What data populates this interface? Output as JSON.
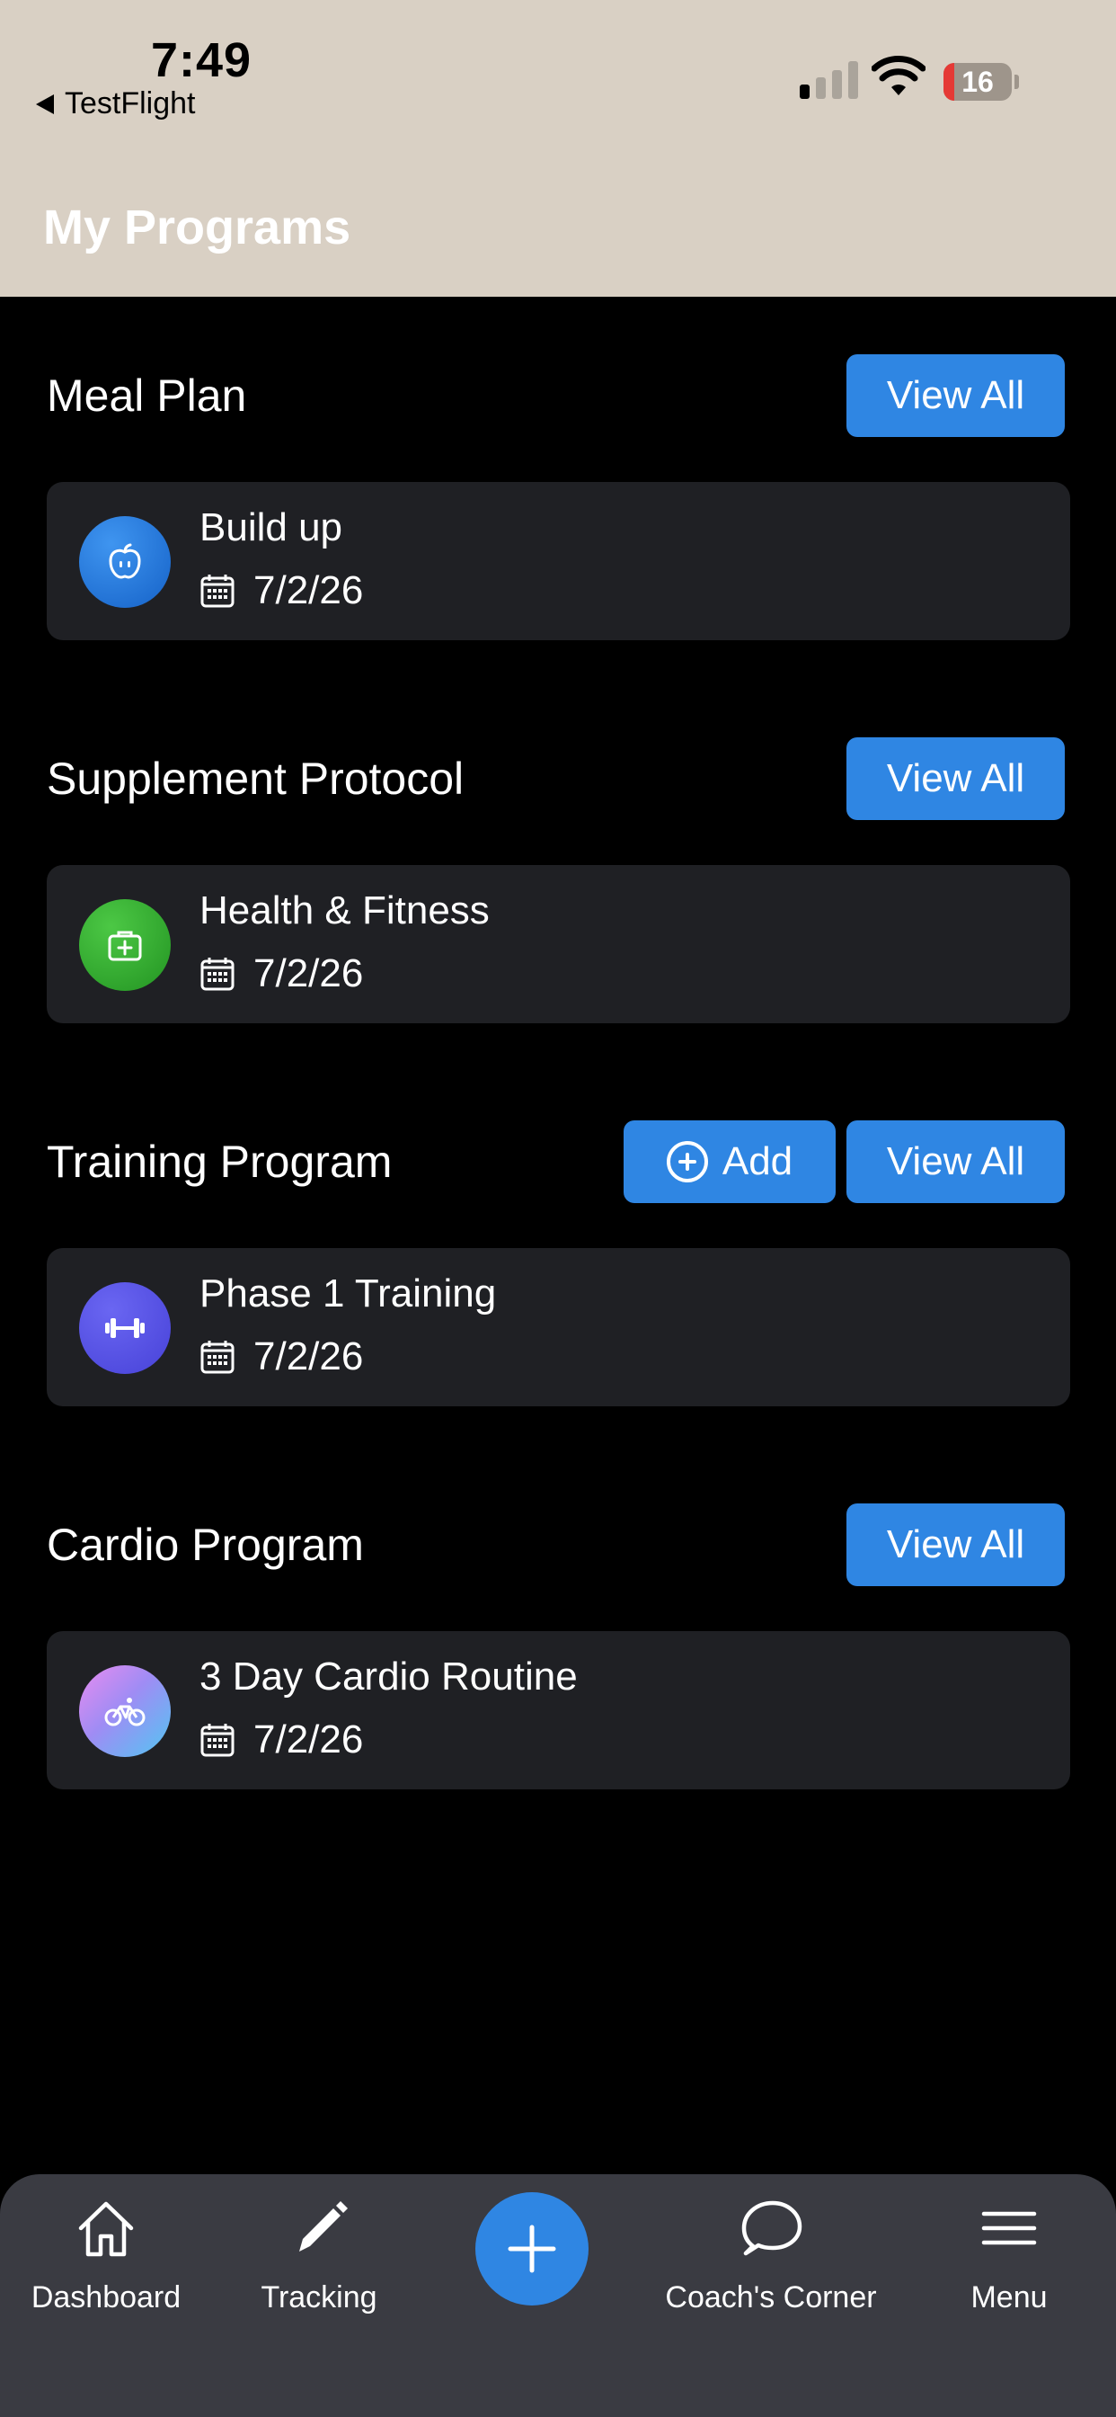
{
  "status_bar": {
    "time": "7:49",
    "back_app": "TestFlight",
    "battery": "16",
    "battery_level": 0.16
  },
  "header": {
    "title": "My Programs"
  },
  "sections": [
    {
      "title": "Meal Plan",
      "view_all_label": "View All",
      "item": {
        "name": "Build up",
        "date": "7/2/26",
        "icon": "apple-icon",
        "icon_color": "#1a6fd4"
      }
    },
    {
      "title": "Supplement Protocol",
      "view_all_label": "View All",
      "item": {
        "name": "Health & Fitness",
        "date": "7/2/26",
        "icon": "medical-kit-icon",
        "icon_color": "#2fa82f"
      }
    },
    {
      "title": "Training Program",
      "add_label": "Add",
      "view_all_label": "View All",
      "item": {
        "name": "Phase 1 Training",
        "date": "7/2/26",
        "icon": "dumbbell-icon",
        "icon_color": "#5350e0"
      }
    },
    {
      "title": "Cardio Program",
      "view_all_label": "View All",
      "item": {
        "name": "3 Day Cardio Routine",
        "date": "7/2/26",
        "icon": "bicycle-icon",
        "icon_color": "#a98cf5"
      }
    }
  ],
  "tabbar": {
    "items": [
      {
        "label": "Dashboard",
        "icon": "home-icon"
      },
      {
        "label": "Tracking",
        "icon": "pencil-icon"
      },
      {
        "label": "Coach's Corner",
        "icon": "chat-bubble-icon"
      },
      {
        "label": "Menu",
        "icon": "hamburger-menu-icon"
      }
    ],
    "center_action_icon": "plus-icon"
  },
  "colors": {
    "header_bg": "#d9d0c4",
    "accent": "#2f86e3",
    "card_bg": "#1f2024",
    "tabbar_bg": "#3a3b42"
  }
}
